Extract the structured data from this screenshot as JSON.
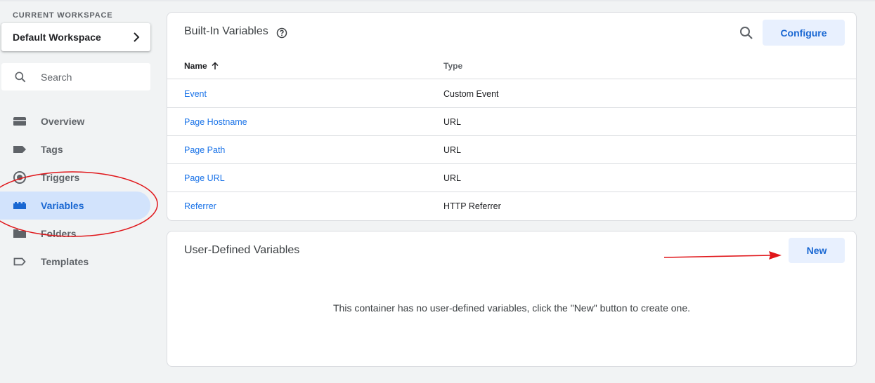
{
  "sidebar": {
    "workspace_label": "CURRENT WORKSPACE",
    "workspace_name": "Default Workspace",
    "search_placeholder": "Search",
    "nav": [
      {
        "label": "Overview",
        "icon": "folder-open-icon"
      },
      {
        "label": "Tags",
        "icon": "tag-icon"
      },
      {
        "label": "Triggers",
        "icon": "trigger-icon"
      },
      {
        "label": "Variables",
        "icon": "variables-icon",
        "active": true
      },
      {
        "label": "Folders",
        "icon": "folder-icon"
      },
      {
        "label": "Templates",
        "icon": "template-icon"
      }
    ]
  },
  "builtin": {
    "title": "Built-In Variables",
    "configure_label": "Configure",
    "columns": {
      "name": "Name",
      "type": "Type"
    },
    "rows": [
      {
        "name": "Event",
        "type": "Custom Event"
      },
      {
        "name": "Page Hostname",
        "type": "URL"
      },
      {
        "name": "Page Path",
        "type": "URL"
      },
      {
        "name": "Page URL",
        "type": "URL"
      },
      {
        "name": "Referrer",
        "type": "HTTP Referrer"
      }
    ]
  },
  "user_defined": {
    "title": "User-Defined Variables",
    "new_label": "New",
    "empty_message": "This container has no user-defined variables, click the \"New\" button to create one."
  },
  "colors": {
    "accent": "#1a73e8",
    "active_nav_bg": "#d2e3fc",
    "button_bg": "#e8f0fe",
    "annotation_red": "#e0161a"
  }
}
